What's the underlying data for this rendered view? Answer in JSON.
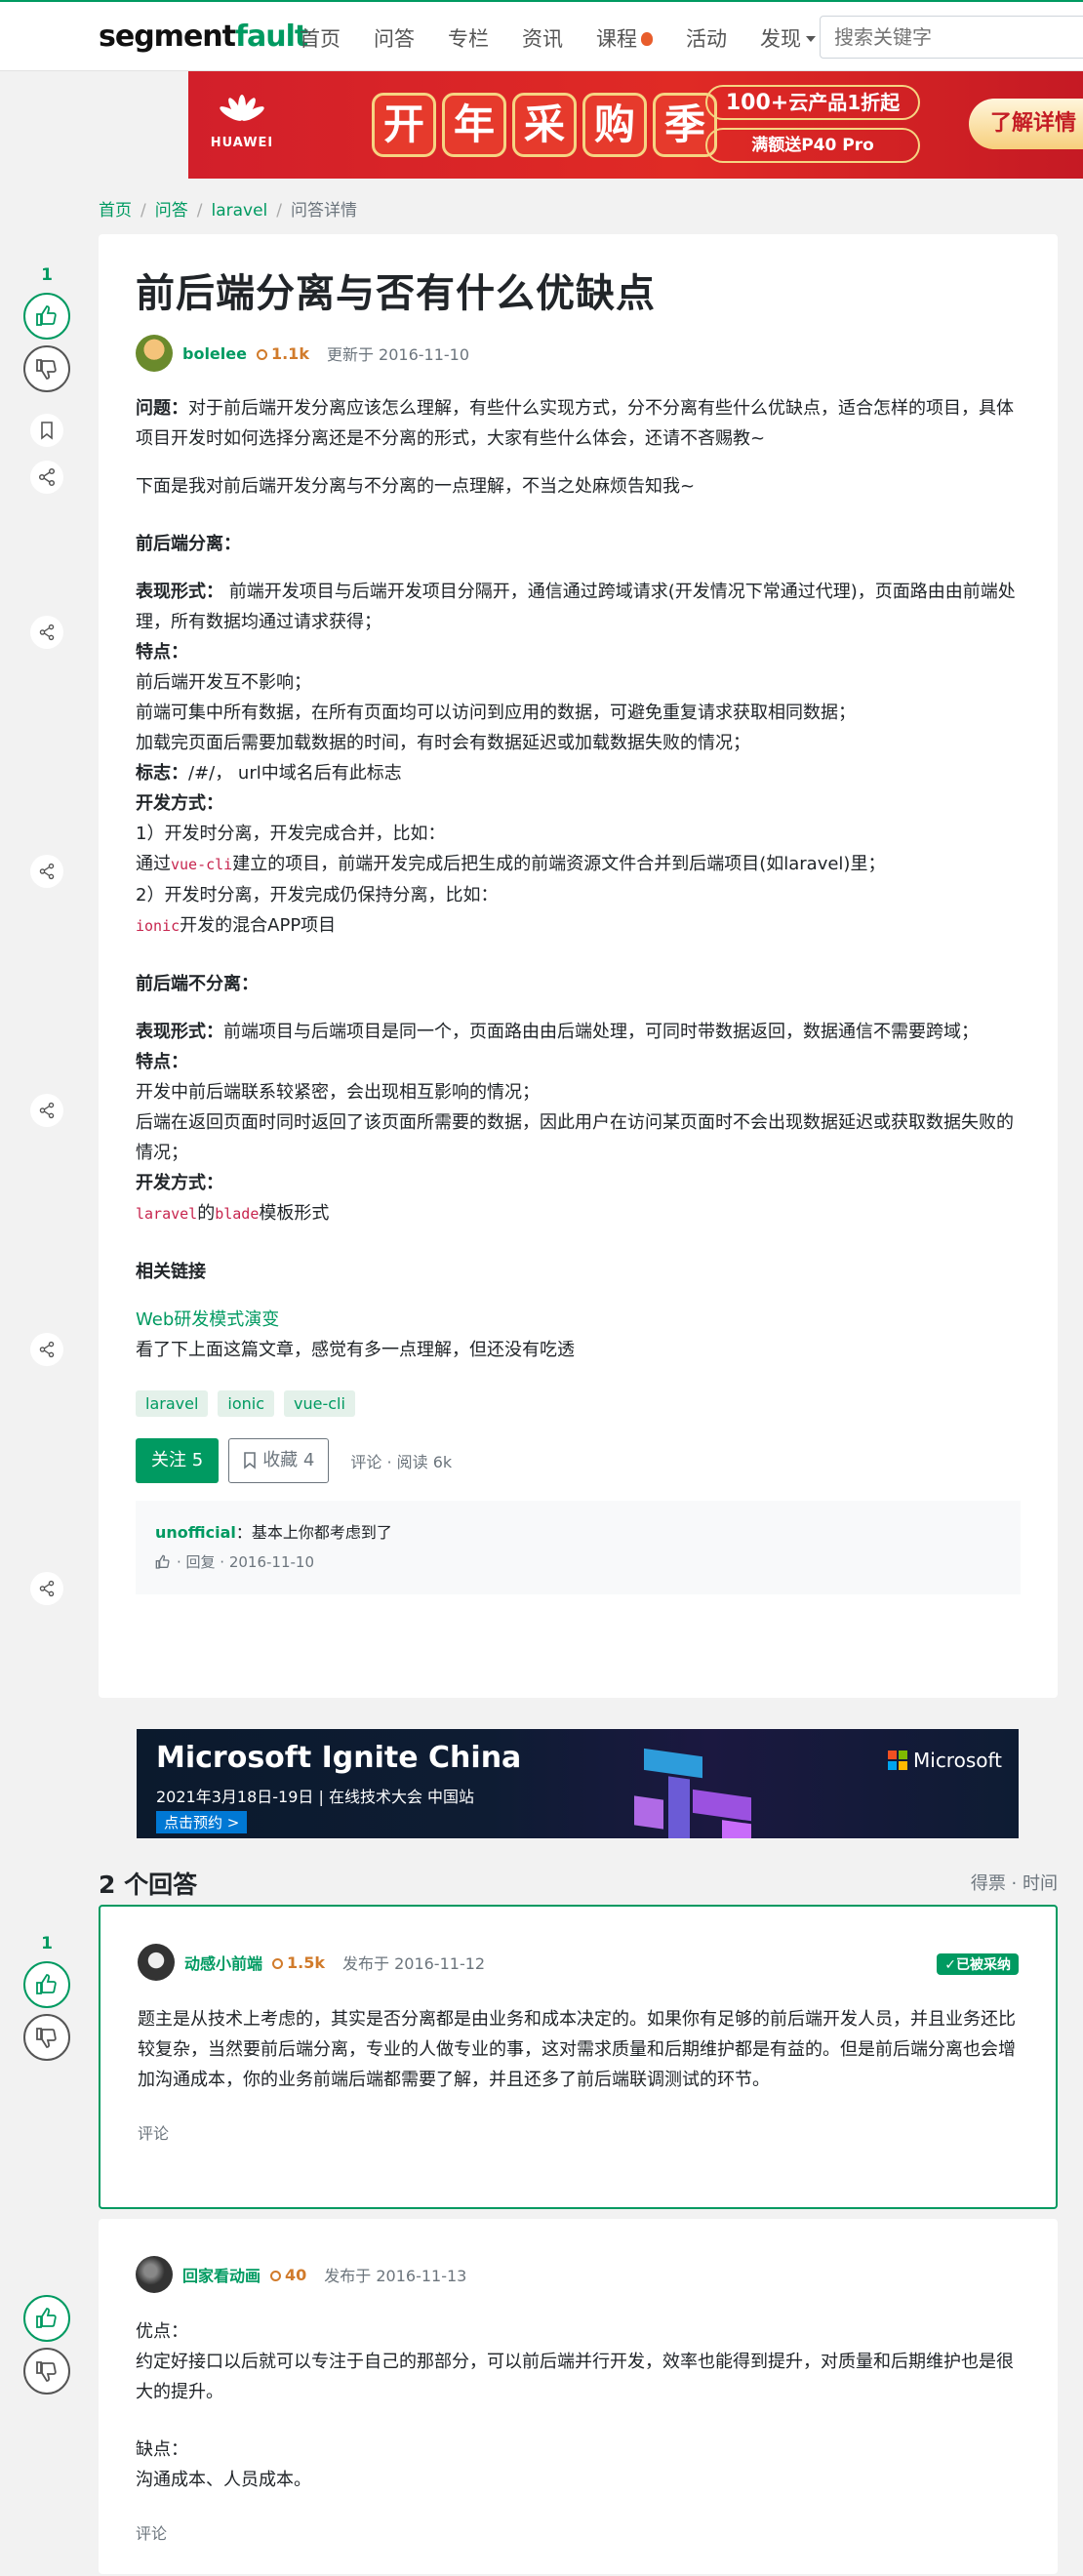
{
  "header": {
    "logo_part1": "segment",
    "logo_part2": "fault",
    "nav": [
      "首页",
      "问答",
      "专栏",
      "资讯",
      "课程",
      "活动",
      "发现"
    ],
    "search_placeholder": "搜索关键字"
  },
  "top_banner": {
    "brand": "HUAWEI",
    "festival_chars": [
      "开",
      "年",
      "采",
      "购",
      "季"
    ],
    "promo1_big": "100+",
    "promo1_rest": "云产品1折起",
    "promo2": "满额送P40 Pro",
    "cta": "了解详情"
  },
  "breadcrumb": [
    "首页",
    "问答",
    "laravel",
    "问答详情"
  ],
  "question": {
    "votes": "1",
    "title": "前后端分离与否有什么优缺点",
    "author": "bolelee",
    "reputation": "1.1k",
    "updated": "更新于 2016-11-10",
    "intro_label": "问题：",
    "intro_text": "对于前后端开发分离应该怎么理解，有些什么实现方式，分不分离有些什么优缺点，适合怎样的项目，具体项目开发时如何选择分离还是不分离的形式，大家有些什么体会，还请不吝赐教~",
    "p2": "下面是我对前后端开发分离与不分离的一点理解，不当之处麻烦告知我~",
    "sep_title": "前后端分离：",
    "sep_form_label": "表现形式：",
    "sep_form_text": " 前端开发项目与后端开发项目分隔开，通信通过跨域请求(开发情况下常通过代理)，页面路由由前端处理，所有数据均通过请求获得；",
    "feature_label": "特点：",
    "sep_f1": "前后端开发互不影响；",
    "sep_f2": "前端可集中所有数据，在所有页面均可以访问到应用的数据，可避免重复请求获取相同数据；",
    "sep_f3": "加载完页面后需要加载数据的时间，有时会有数据延迟或加载数据失败的情况；",
    "mark_label": "标志：",
    "mark_text": "/#/， url中域名后有此标志",
    "dev_label": "开发方式：",
    "dev1": "1）开发时分离，开发完成合并，比如：",
    "dev1_pre": "通过",
    "dev1_code": "vue-cli",
    "dev1_post": "建立的项目，前端开发完成后把生成的前端资源文件合并到后端项目(如laravel)里；",
    "dev2": "2）开发时分离，开发完成仍保持分离，比如：",
    "dev2_code": "ionic",
    "dev2_post": "开发的混合APP项目",
    "nosep_title": "前后端不分离：",
    "nosep_form_label": "表现形式：",
    "nosep_form_text": "前端项目与后端项目是同一个，页面路由由后端处理，可同时带数据返回，数据通信不需要跨域；",
    "nosep_f1": "开发中前后端联系较紧密，会出现相互影响的情况；",
    "nosep_f2": "后端在返回页面时同时返回了该页面所需要的数据，因此用户在访问某页面时不会出现数据延迟或获取数据失败的情况；",
    "nosep_dev_code1": "laravel",
    "nosep_dev_mid": "的",
    "nosep_dev_code2": "blade",
    "nosep_dev_post": "模板形式",
    "related_title": "相关链接",
    "related_link": "Web研发模式演变",
    "related_note": "看了下上面这篇文章，感觉有多一点理解，但还没有吃透",
    "tags": [
      "laravel",
      "ionic",
      "vue-cli"
    ],
    "follow_btn": "关注 5",
    "fav_btn": "收藏 4",
    "act_meta": "评论 · 阅读 6k",
    "comment": {
      "user": "unofficial",
      "text": "：基本上你都考虑到了",
      "meta": "· 回复 · 2016-11-10"
    }
  },
  "ad": {
    "title": "Microsoft Ignite China",
    "subtitle": "2021年3月18日-19日 | 在线技术大会 中国站",
    "button": "点击预约 >",
    "brand": "Microsoft"
  },
  "answers_header": {
    "title": "2 个回答",
    "sort": "得票 · 时间"
  },
  "answers": [
    {
      "votes": "1",
      "author": "动感小前端",
      "reputation": "1.5k",
      "date": "发布于 2016-11-12",
      "accepted": "✓已被采纳",
      "text": "题主是从技术上考虑的，其实是否分离都是由业务和成本决定的。如果你有足够的前后端开发人员，并且业务还比较复杂，当然要前后端分离，专业的人做专业的事，这对需求质量和后期维护都是有益的。但是前后端分离也会增加沟通成本，你的业务前端后端都需要了解，并且还多了前后端联调测试的环节。",
      "comment": "评论"
    },
    {
      "votes": "",
      "author": "回家看动画",
      "reputation": "40",
      "date": "发布于 2016-11-13",
      "pros_label": "优点：",
      "pros": "约定好接口以后就可以专注于自己的那部分，可以前后端并行开发，效率也能得到提升，对质量和后期维护也是很大的提升。",
      "cons_label": "缺点：",
      "cons": "沟通成本、人员成本。",
      "comment": "评论"
    }
  ],
  "colors": {
    "brand_green": "#009a61",
    "reputation_orange": "#d17b2b",
    "code_pink": "#c7254e"
  }
}
